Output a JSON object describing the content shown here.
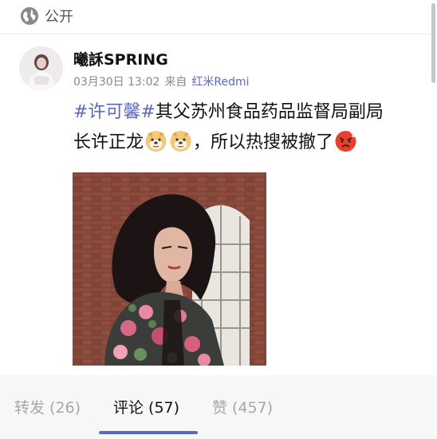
{
  "visibility": {
    "label": "公开",
    "icon": "globe-icon"
  },
  "post": {
    "username": "曦訸SPRING",
    "timestamp": "03月30日 13:02",
    "source_prefix": "来自",
    "source": "红米Redmi",
    "hashtag": "#许可馨#",
    "text_line1": "其父苏州食品药品监督局副局",
    "text_line2a": "长许正龙",
    "text_line2b": "，所以热搜被撤了",
    "emojis": [
      "doge-emoji-icon",
      "doge-emoji-icon",
      "angry-emoji-icon"
    ]
  },
  "tabs": {
    "repost": "转发 (26)",
    "comments": "评论 (57)",
    "likes": "赞 (457)"
  },
  "colors": {
    "accent": "#5b6ab8",
    "muted": "#8a8a8a",
    "tab_bar_bg": "#f7f7f7"
  }
}
